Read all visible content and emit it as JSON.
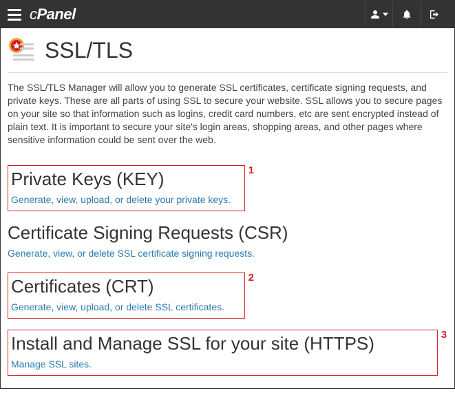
{
  "header": {
    "logo_text": "cPanel"
  },
  "page": {
    "title": "SSL/TLS",
    "description": "The SSL/TLS Manager will allow you to generate SSL certificates, certificate signing requests, and private keys. These are all parts of using SSL to secure your website. SSL allows you to secure pages on your site so that information such as logins, credit card numbers, etc are sent encrypted instead of plain text. It is important to secure your site's login areas, shopping areas, and other pages where sensitive information could be sent over the web."
  },
  "sections": {
    "key": {
      "title": "Private Keys (KEY)",
      "link": "Generate, view, upload, or delete your private keys.",
      "annotation": "1"
    },
    "csr": {
      "title": "Certificate Signing Requests (CSR)",
      "link": "Generate, view, or delete SSL certificate signing requests."
    },
    "crt": {
      "title": "Certificates (CRT)",
      "link": "Generate, view, upload, or delete SSL certificates.",
      "annotation": "2"
    },
    "install": {
      "title": "Install and Manage SSL for your site (HTTPS)",
      "link": "Manage SSL sites.",
      "annotation": "3"
    }
  }
}
